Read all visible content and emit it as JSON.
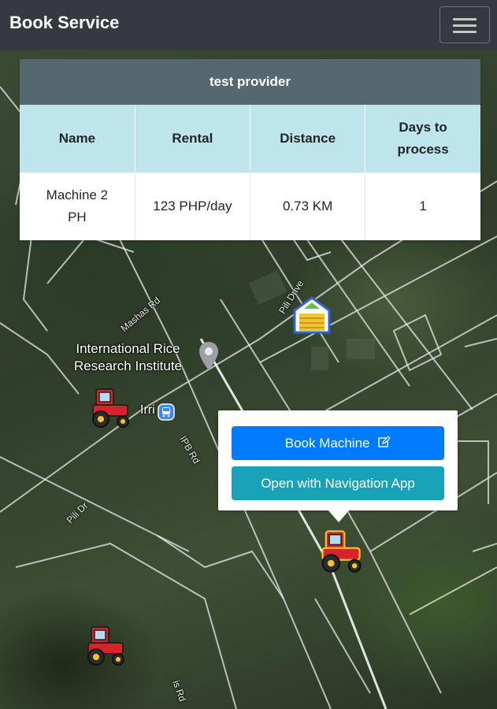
{
  "navbar": {
    "brand": "Book Service",
    "menu_icon": "hamburger-icon"
  },
  "provider_table": {
    "title": "test provider",
    "columns": [
      "Name",
      "Rental",
      "Distance",
      "Days to process"
    ],
    "rows": [
      {
        "name": "Machine 2 PH",
        "rental": "123 PHP/day",
        "distance": "0.73 KM",
        "days": "1"
      }
    ]
  },
  "popup": {
    "book_label": "Book Machine",
    "book_icon": "edit-icon",
    "navigate_label": "Open with Navigation App"
  },
  "map": {
    "place_label_line1": "International Rice",
    "place_label_line2": "Research Institute",
    "irri_label": "Irri",
    "roads": [
      "Mashas Rd",
      "Pili Drive",
      "IPB Rd",
      "Pili Dr",
      "Pili Dr",
      "is Rd"
    ],
    "markers": [
      "tractor-icon",
      "farm-field-icon",
      "place-pin-icon",
      "bus-stop-icon"
    ]
  },
  "colors": {
    "navbar": "#343a40",
    "table_title": "#556870",
    "table_header": "#bee5eb",
    "primary": "#007bff",
    "info": "#17a2b8"
  }
}
